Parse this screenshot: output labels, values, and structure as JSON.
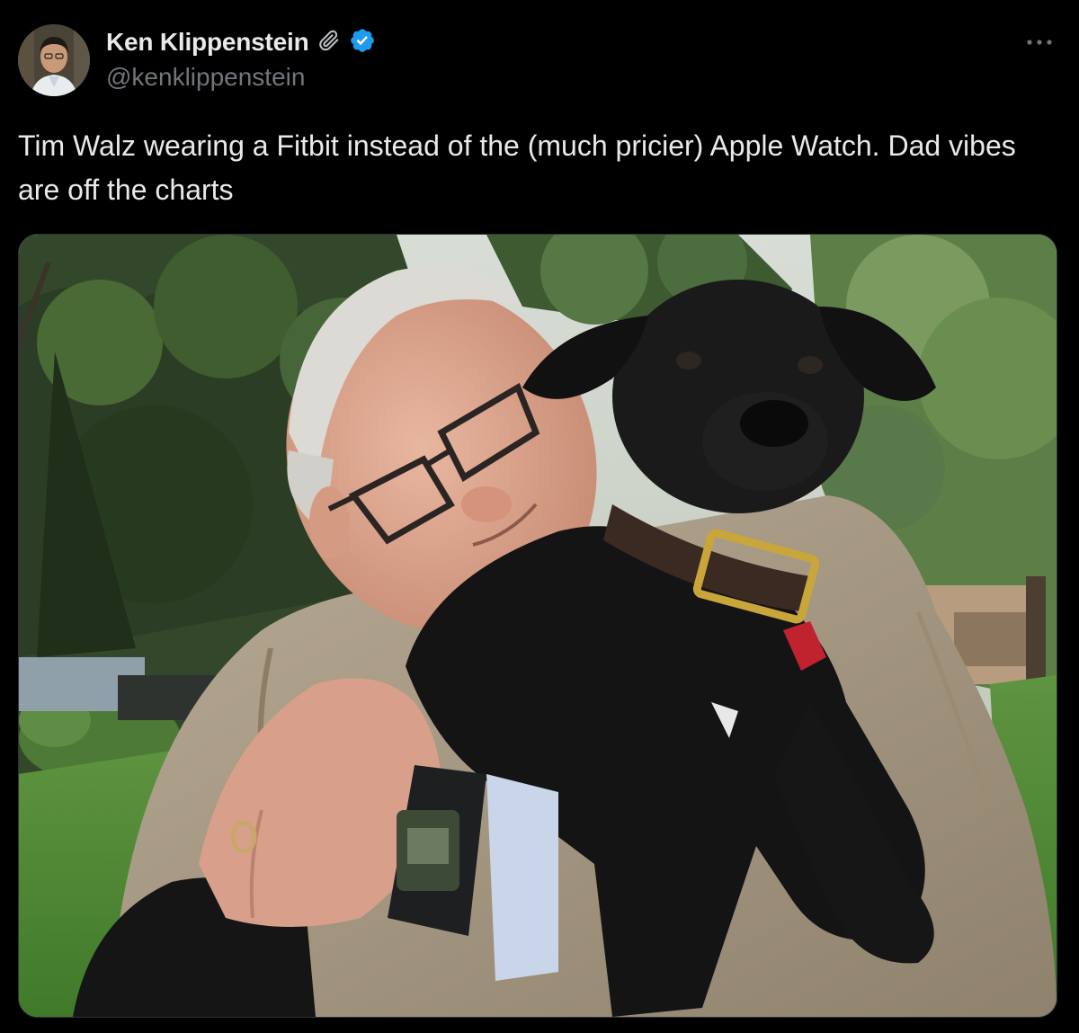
{
  "author": {
    "display_name": "Ken Klippenstein",
    "handle": "@kenklippenstein",
    "badges": [
      "paperclip-icon",
      "verified-badge-icon"
    ],
    "verified_color": "#1d9bf0"
  },
  "tweet": {
    "text": "Tim Walz wearing a Fitbit instead of the (much pricier) Apple Watch. Dad vibes are off the charts"
  },
  "media": {
    "type": "photo"
  },
  "actions": {
    "more_icon": "more-horizontal-icon"
  },
  "colors": {
    "background": "#000000",
    "text_primary": "#e7e9ea",
    "text_secondary": "#71767b"
  }
}
